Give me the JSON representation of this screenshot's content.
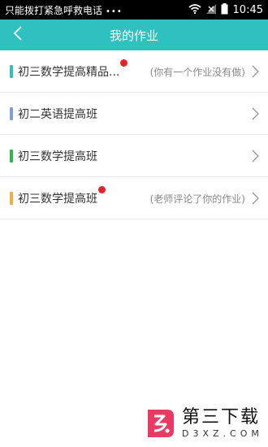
{
  "status_bar": {
    "carrier_text": "只能拨打紧急呼救电话",
    "dots": "•••",
    "time": "10:45",
    "icons": [
      "wifi-icon",
      "signal-icon",
      "battery-icon"
    ]
  },
  "header": {
    "title": "我的作业",
    "back_icon": "chevron-left-icon",
    "background_color": "#2fc0c0"
  },
  "classes": [
    {
      "name": "初三数学提高精品...",
      "note": "(你有一个作业没有做)",
      "color": "#2fc0c0",
      "badge": true
    },
    {
      "name": "初二英语提高班",
      "note": "",
      "color": "#7fa0d8",
      "badge": false
    },
    {
      "name": "初三数学提高班",
      "note": "",
      "color": "#2eb84a",
      "badge": false
    },
    {
      "name": "初三数学提高班",
      "note": "(老师评论了你的作业)",
      "color": "#f0b040",
      "badge": true
    }
  ],
  "badge_color": "#e8222a",
  "watermark": {
    "cn": "第三下载",
    "en": "D3XZ.COM"
  }
}
